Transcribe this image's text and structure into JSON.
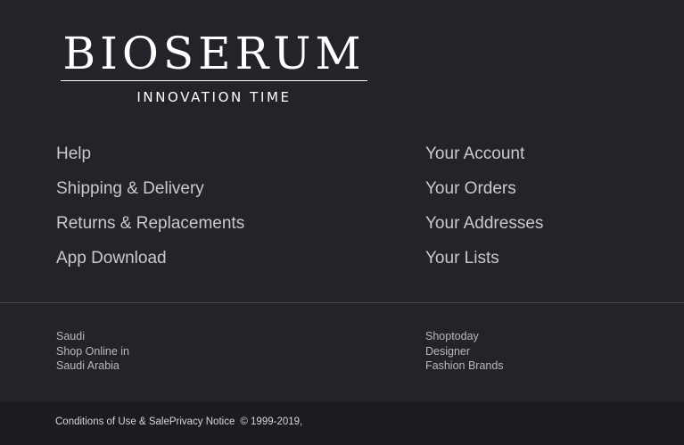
{
  "brand": {
    "name": "BIOSERUM",
    "tagline": "INNOVATION TIME"
  },
  "links_left": [
    "Help",
    "Shipping & Delivery",
    "Returns & Replacements",
    "App Download"
  ],
  "links_right": [
    "Your Account",
    "Your Orders",
    "Your Addresses",
    "Your Lists"
  ],
  "region_left": {
    "line1": "Saudi",
    "line2": "Shop Online in",
    "line3": "Saudi Arabia"
  },
  "region_right": {
    "line1": "Shoptoday",
    "line2": "Designer",
    "line3": "Fashion Brands"
  },
  "footer": {
    "conditions": "Conditions of Use & Sale",
    "privacy": "Privacy Notice",
    "copyright": "© 1999-2019,"
  },
  "colors": {
    "background": "#232429",
    "bottom_bar": "#1b1c20",
    "link_text": "#c9cacd"
  }
}
